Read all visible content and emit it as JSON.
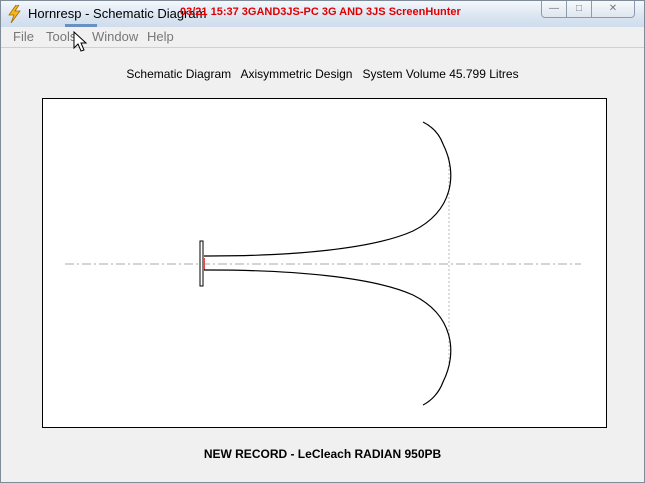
{
  "window": {
    "title": "Hornresp - Schematic Diagram",
    "overlay_text": "03/21  15:37  3GAND3JS-PC  3G AND 3JS  ScreenHunter",
    "controls": [
      "minimize-icon",
      "maximize-icon",
      "close-icon"
    ]
  },
  "menu": {
    "file": "File",
    "tools": "Tools",
    "window": "Window",
    "help": "Help"
  },
  "header": {
    "diagram_label": "Schematic Diagram",
    "design_label": "Axisymmetric Design",
    "volume_label": "System Volume 45.799 Litres"
  },
  "footer": {
    "record": "NEW RECORD - LeCleach RADIAN 950PB"
  },
  "colors": {
    "axis_line": "#aaaaaa",
    "driver_accent": "#e05050",
    "overlay_red": "#e00000"
  }
}
